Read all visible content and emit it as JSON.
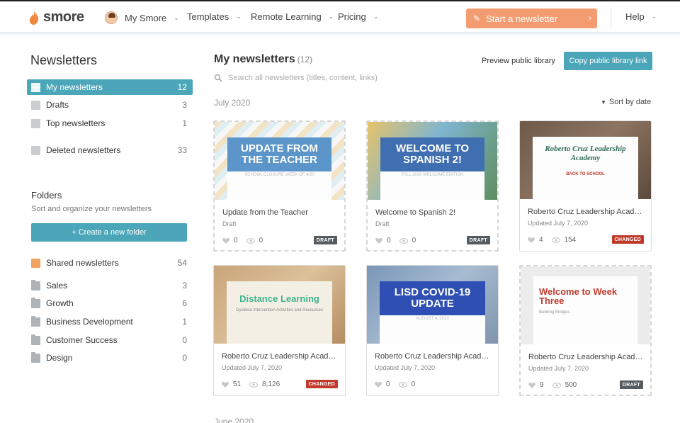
{
  "header": {
    "logo": "smore",
    "nav": [
      {
        "label": "My Smore"
      },
      {
        "label": "Templates"
      },
      {
        "label": "Remote Learning"
      },
      {
        "label": "Pricing"
      }
    ],
    "cta_label": "Start a newsletter",
    "help_label": "Help"
  },
  "sidebar": {
    "title": "Newsletters",
    "items": [
      {
        "label": "My newsletters",
        "count": "12"
      },
      {
        "label": "Drafts",
        "count": "3"
      },
      {
        "label": "Top newsletters",
        "count": "1"
      },
      {
        "label": "Deleted newsletters",
        "count": "33"
      }
    ],
    "folders_title": "Folders",
    "folders_subtitle": "Sort and organize your newsletters",
    "new_folder_label": "+ Create a new folder",
    "folders": [
      {
        "label": "Shared newsletters",
        "count": "54"
      },
      {
        "label": "Sales",
        "count": "3"
      },
      {
        "label": "Growth",
        "count": "6"
      },
      {
        "label": "Business Development",
        "count": "1"
      },
      {
        "label": "Customer Success",
        "count": "0"
      },
      {
        "label": "Design",
        "count": "0"
      }
    ]
  },
  "main": {
    "title": "My newsletters",
    "count": "(12)",
    "search_placeholder": "Search all newsletters (titles, content, links)",
    "preview_label": "Preview public library",
    "copy_label": "Copy public library link",
    "sort_label": "Sort by date",
    "months": [
      "July 2020",
      "June 2020"
    ],
    "cards": [
      {
        "thumb_text": "UPDATE FROM THE TEACHER",
        "thumb_sub": "SCHOOL CLOSURE WEEK OF 4/20",
        "title": "Update from the Teacher",
        "meta": "Draft",
        "likes": "0",
        "views": "0",
        "badge": "DRAFT"
      },
      {
        "thumb_text": "WELCOME TO SPANISH 2!",
        "thumb_sub": "FALL 2020 WELCOME EDITION",
        "title": "Welcome to Spanish 2!",
        "meta": "Draft",
        "likes": "0",
        "views": "0",
        "badge": "DRAFT"
      },
      {
        "thumb_text": "Roberto Cruz Leadership Academy",
        "thumb_sub": "BACK TO SCHOOL",
        "title": "Roberto Cruz Leadership Academy",
        "meta": "Updated July 7, 2020",
        "likes": "4",
        "views": "154",
        "badge": "CHANGED"
      },
      {
        "thumb_text": "Distance Learning",
        "thumb_sub": "Dyslexia Intervention Activities and Resources",
        "title": "Roberto Cruz Leadership Academy",
        "meta": "Updated July 7, 2020",
        "likes": "51",
        "views": "8,126",
        "badge": "CHANGED"
      },
      {
        "thumb_text": "LISD COVID-19 UPDATE",
        "thumb_sub": "AUGUST 4, 2020",
        "title": "Roberto Cruz Leadership Academy",
        "meta": "Updated July 7, 2020",
        "likes": "0",
        "views": "0",
        "badge": ""
      },
      {
        "thumb_text": "Welcome to Week Three",
        "thumb_sub": "Building Bridges",
        "title": "Roberto Cruz Leadership Academy",
        "meta": "Updated July 7, 2020",
        "likes": "9",
        "views": "500",
        "badge": "DRAFT"
      }
    ]
  },
  "colors": {
    "accent": "#4aa6b8",
    "cta": "#f39c72",
    "changed": "#c0392b",
    "draft": "#555b5f"
  }
}
